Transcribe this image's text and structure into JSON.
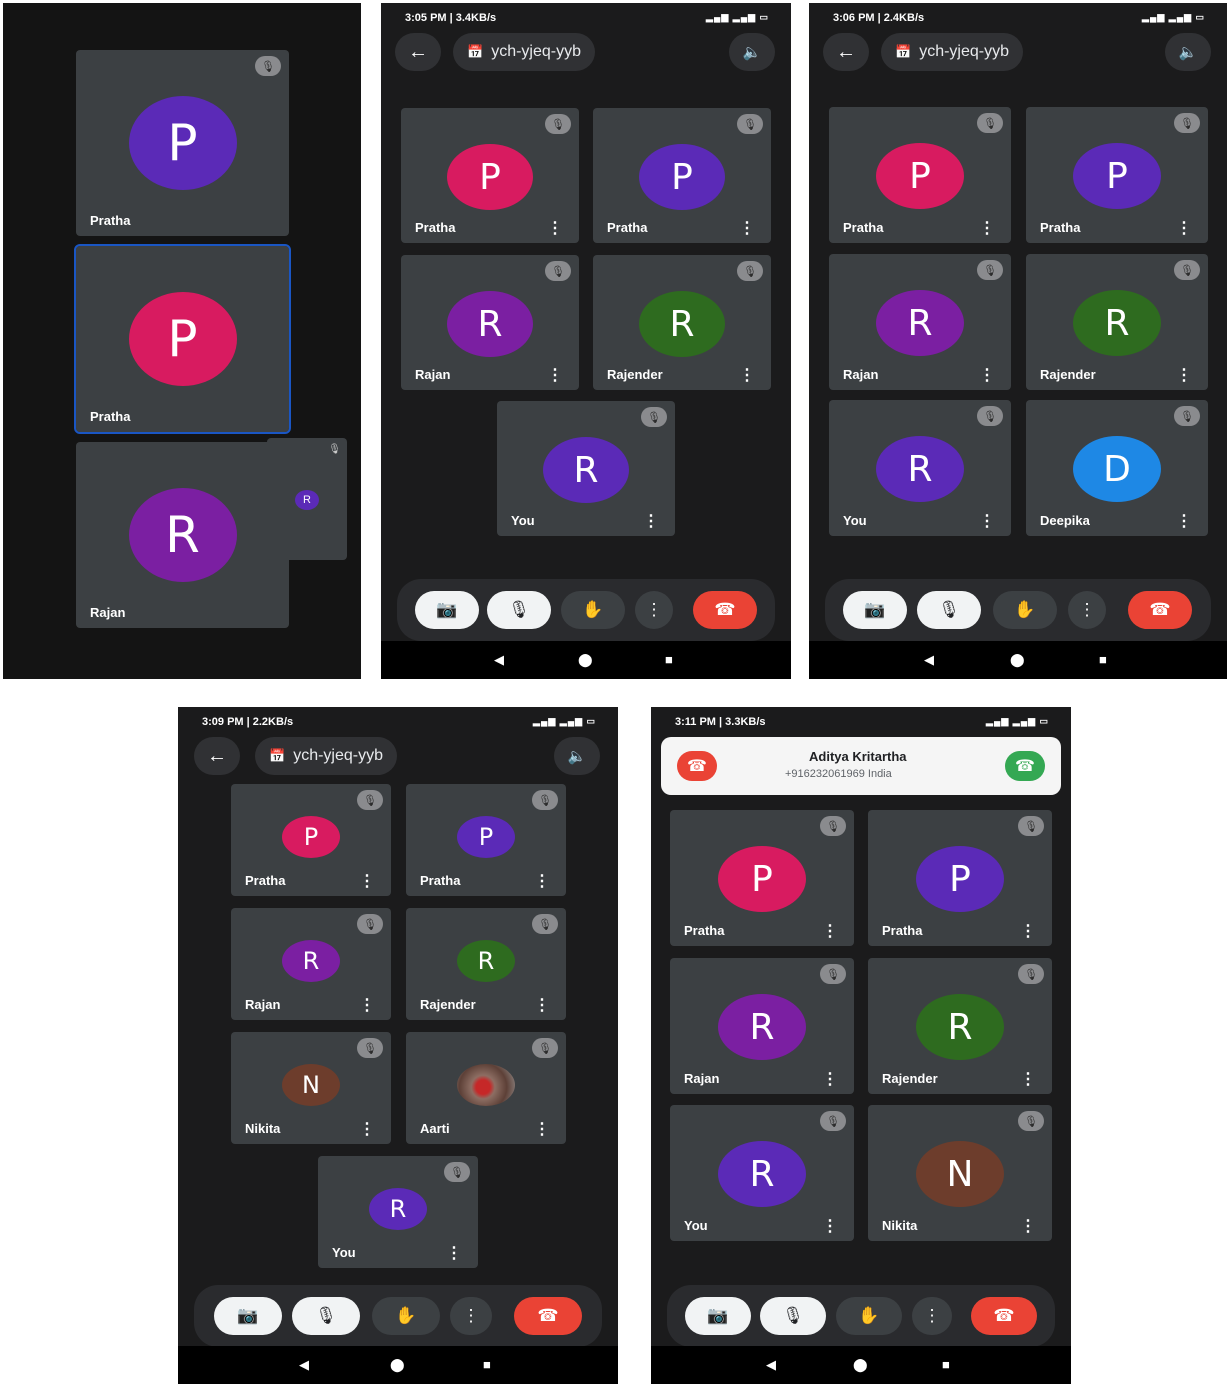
{
  "colors": {
    "pink": "#d81b60",
    "purple": "#5b2ab7",
    "violet": "#7b1fa2",
    "green": "#2e6b1f",
    "blue": "#1e88e5",
    "brown": "#6d3d2c",
    "end": "#ea4335",
    "accept": "#34a853"
  },
  "icons": {
    "back": "←",
    "speaker": "🔈",
    "calendar": "📅",
    "mic_off": "🎙",
    "cam_off": "📷",
    "hand": "✋",
    "more": "⋮",
    "end": "☎",
    "tri": "◀",
    "circle": "⬤",
    "square": "■"
  },
  "s1": {
    "tiles": [
      {
        "name": "Pratha",
        "initial": "P",
        "color": "purple"
      },
      {
        "name": "Pratha",
        "initial": "P",
        "color": "pink"
      },
      {
        "name": "Rajan",
        "initial": "R",
        "color": "violet"
      }
    ],
    "pip_initial": "R"
  },
  "s2": {
    "time": "3:05 PM | 3.4KB/s",
    "meeting_code": "ych-yjeq-yyb",
    "tiles": [
      {
        "name": "Pratha",
        "initial": "P"
      },
      {
        "name": "Pratha",
        "initial": "P"
      },
      {
        "name": "Rajan",
        "initial": "R"
      },
      {
        "name": "Rajender",
        "initial": "R"
      },
      {
        "name": "You",
        "initial": "R"
      }
    ]
  },
  "s3": {
    "time": "3:06 PM | 2.4KB/s",
    "meeting_code": "ych-yjeq-yyb",
    "tiles": [
      {
        "name": "Pratha",
        "initial": "P"
      },
      {
        "name": "Pratha",
        "initial": "P"
      },
      {
        "name": "Rajan",
        "initial": "R"
      },
      {
        "name": "Rajender",
        "initial": "R"
      },
      {
        "name": "You",
        "initial": "R"
      },
      {
        "name": "Deepika",
        "initial": "D"
      }
    ]
  },
  "s4": {
    "time": "3:09 PM | 2.2KB/s",
    "meeting_code": "ych-yjeq-yyb",
    "tiles": [
      {
        "name": "Pratha",
        "initial": "P"
      },
      {
        "name": "Pratha",
        "initial": "P"
      },
      {
        "name": "Rajan",
        "initial": "R"
      },
      {
        "name": "Rajender",
        "initial": "R"
      },
      {
        "name": "Nikita",
        "initial": "N"
      },
      {
        "name": "Aarti",
        "initial": ""
      },
      {
        "name": "You",
        "initial": "R"
      }
    ]
  },
  "s5": {
    "time": "3:11 PM | 3.3KB/s",
    "caller_name": "Aditya Kritartha",
    "caller_number": "+916232061969  India",
    "tiles": [
      {
        "name": "Pratha",
        "initial": "P"
      },
      {
        "name": "Pratha",
        "initial": "P"
      },
      {
        "name": "Rajan",
        "initial": "R"
      },
      {
        "name": "Rajender",
        "initial": "R"
      },
      {
        "name": "You",
        "initial": "R"
      },
      {
        "name": "Nikita",
        "initial": "N"
      }
    ]
  }
}
